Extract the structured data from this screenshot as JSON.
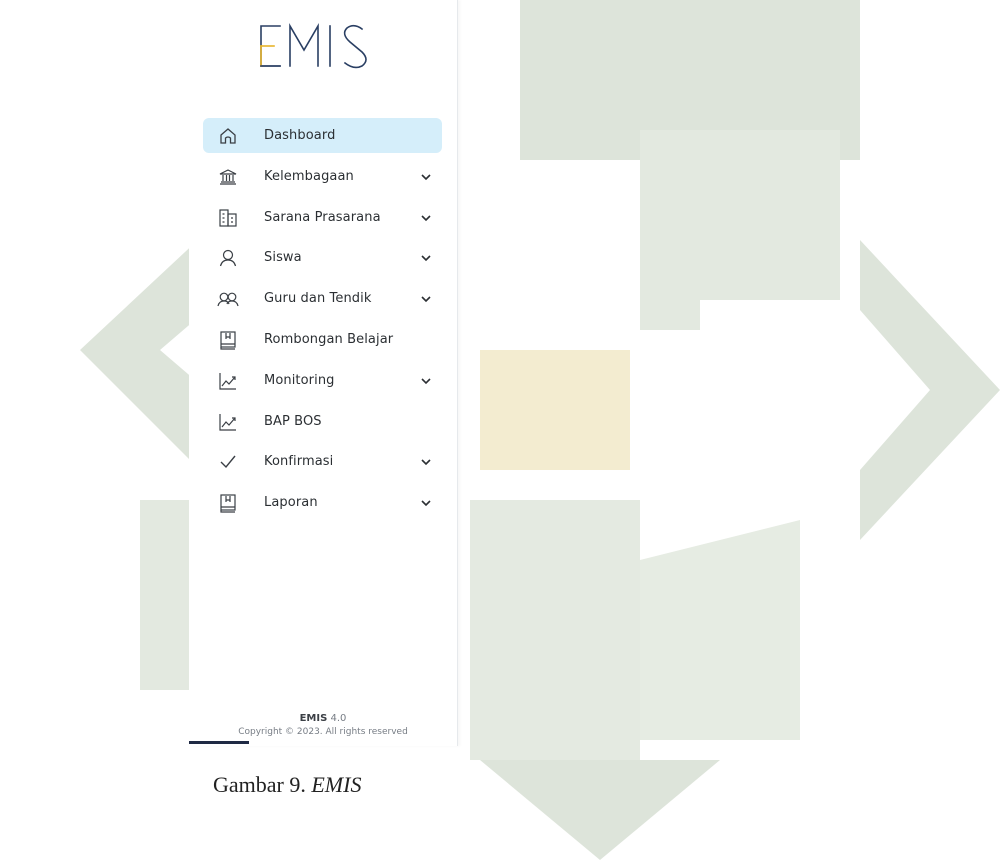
{
  "logo": {
    "text": "EMIS"
  },
  "menu": [
    {
      "label": "Dashboard",
      "icon": "home-icon",
      "active": true,
      "has_submenu": false
    },
    {
      "label": "Kelembagaan",
      "icon": "bank-icon",
      "active": false,
      "has_submenu": true
    },
    {
      "label": "Sarana Prasarana",
      "icon": "building-icon",
      "active": false,
      "has_submenu": true
    },
    {
      "label": "Siswa",
      "icon": "user-icon",
      "active": false,
      "has_submenu": true
    },
    {
      "label": "Guru dan Tendik",
      "icon": "users-icon",
      "active": false,
      "has_submenu": true
    },
    {
      "label": "Rombongan Belajar",
      "icon": "book-icon",
      "active": false,
      "has_submenu": false
    },
    {
      "label": "Monitoring",
      "icon": "chart-line-icon",
      "active": false,
      "has_submenu": true
    },
    {
      "label": "BAP BOS",
      "icon": "chart-line-icon",
      "active": false,
      "has_submenu": false
    },
    {
      "label": "Konfirmasi",
      "icon": "check-icon",
      "active": false,
      "has_submenu": true
    },
    {
      "label": "Laporan",
      "icon": "book-icon",
      "active": false,
      "has_submenu": true
    }
  ],
  "footer": {
    "app_name": "EMIS",
    "version": "4.0",
    "copyright": "Copyright © 2023. All rights reserved"
  },
  "caption": {
    "prefix": "Gambar 9. ",
    "title": "EMIS"
  },
  "colors": {
    "active_bg": "#d5eefa",
    "logo_navy": "#2a3f63",
    "logo_gold": "#e8b42a",
    "watermark": "#dbe3d8"
  }
}
